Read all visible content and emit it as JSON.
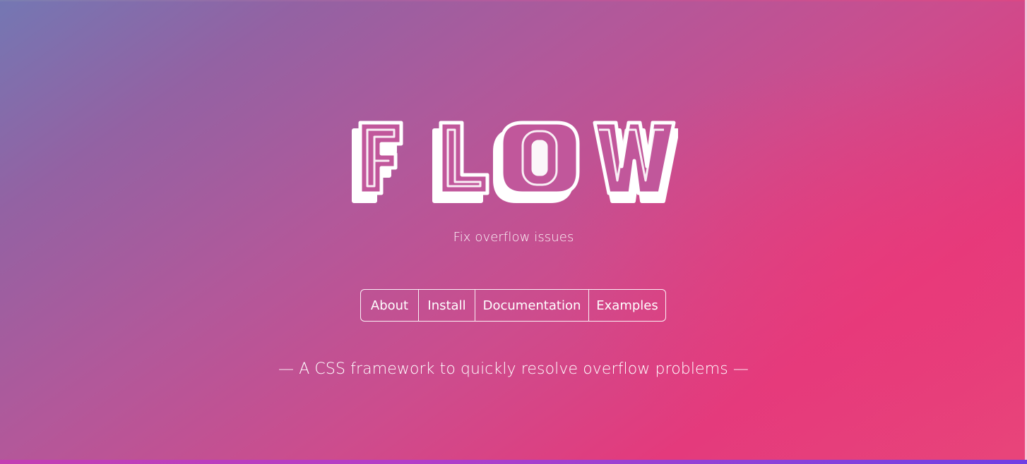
{
  "hero": {
    "logo_text": "FLOW",
    "tagline": "Fix overflow issues",
    "description": "— A CSS framework to quickly resolve overflow problems —"
  },
  "nav": {
    "items": [
      {
        "label": "About"
      },
      {
        "label": "Install"
      },
      {
        "label": "Documentation"
      },
      {
        "label": "Examples"
      }
    ]
  },
  "colors": {
    "gradient_start": "#7477b3",
    "gradient_mid": "#cd4c8d",
    "gradient_end": "#e43a7c",
    "text": "#ffffff",
    "bottom_bar_start": "#c33fb2",
    "bottom_bar_end": "#6f3fe4"
  }
}
